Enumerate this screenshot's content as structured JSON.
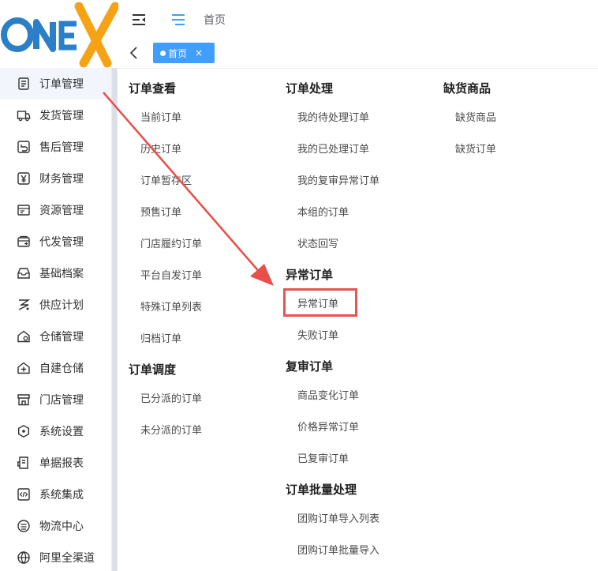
{
  "logo": {
    "text": "ONEX",
    "colors": {
      "blue": "#2b7fc9",
      "orange": "#f5a214"
    }
  },
  "header": {
    "collapse_icon": "menu-fold-icon",
    "menu_icon": "menu-list-icon",
    "title": "首页"
  },
  "tags": {
    "back_icon": "chevron-left-icon",
    "active_tag": {
      "label": "首页",
      "close": "×"
    }
  },
  "sidebar": {
    "items": [
      {
        "label": "订单管理",
        "icon": "order-icon",
        "active": true
      },
      {
        "label": "发货管理",
        "icon": "truck-icon"
      },
      {
        "label": "售后管理",
        "icon": "return-icon"
      },
      {
        "label": "财务管理",
        "icon": "yen-icon"
      },
      {
        "label": "资源管理",
        "icon": "resource-icon"
      },
      {
        "label": "代发管理",
        "icon": "proxy-icon"
      },
      {
        "label": "基础档案",
        "icon": "archive-icon"
      },
      {
        "label": "供应计划",
        "icon": "plan-icon"
      },
      {
        "label": "仓储管理",
        "icon": "warehouse-icon"
      },
      {
        "label": "自建仓储",
        "icon": "home-plus-icon"
      },
      {
        "label": "门店管理",
        "icon": "store-icon"
      },
      {
        "label": "系统设置",
        "icon": "settings-icon"
      },
      {
        "label": "单据报表",
        "icon": "report-icon"
      },
      {
        "label": "系统集成",
        "icon": "code-icon"
      },
      {
        "label": "物流中心",
        "icon": "logistics-icon"
      },
      {
        "label": "阿里全渠道",
        "icon": "globe-icon"
      }
    ]
  },
  "mega_menu": {
    "col1": {
      "group1_title": "订单查看",
      "group1_links": [
        "当前订单",
        "历史订单",
        "订单暂存区",
        "预售订单",
        "门店履约订单",
        "平台自发订单",
        "特殊订单列表",
        "归档订单"
      ],
      "group2_title": "订单调度",
      "group2_links": [
        "已分派的订单",
        "未分派的订单"
      ]
    },
    "col2": {
      "group1_title": "订单处理",
      "group1_links": [
        "我的待处理订单",
        "我的已处理订单",
        "我的复审异常订单",
        "本组的订单",
        "状态回写"
      ],
      "group2_title": "异常订单",
      "group2_links": [
        "异常订单",
        "失败订单"
      ],
      "group3_title": "复审订单",
      "group3_links": [
        "商品变化订单",
        "价格异常订单",
        "已复审订单"
      ],
      "group4_title": "订单批量处理",
      "group4_links": [
        "团购订单导入列表",
        "团购订单批量导入"
      ]
    },
    "col3": {
      "group1_title": "缺货商品",
      "group1_links": [
        "缺货商品",
        "缺货订单"
      ]
    }
  },
  "annotation": {
    "arrow_color": "#e84e4a",
    "highlight_color": "#e15552"
  },
  "theme": {
    "primary": "#409eff",
    "text": "#303133"
  }
}
